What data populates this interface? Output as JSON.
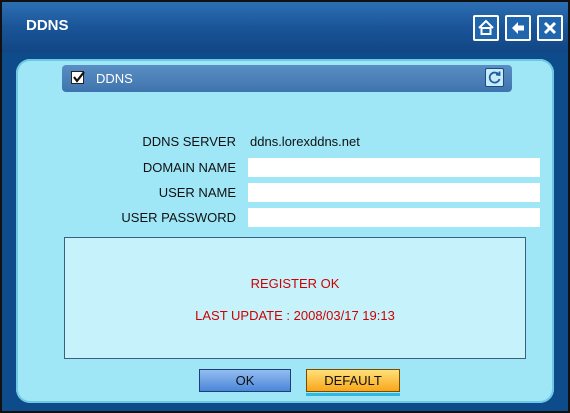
{
  "window": {
    "title": "DDNS"
  },
  "titlebar_buttons": [
    {
      "icon": "home-icon"
    },
    {
      "icon": "back-arrow-icon"
    },
    {
      "icon": "close-icon"
    }
  ],
  "section": {
    "label": "DDNS",
    "checked": true,
    "refresh_icon": "refresh-icon"
  },
  "fields": {
    "server_label": "DDNS SERVER",
    "server_value": "ddns.lorexddns.net",
    "domain_label": "DOMAIN NAME",
    "domain_value": "",
    "user_label": "USER NAME",
    "user_value": "",
    "password_label": "USER PASSWORD",
    "password_value": ""
  },
  "status": {
    "message": "REGISTER OK",
    "last_update": "LAST UPDATE : 2008/03/17 19:13"
  },
  "buttons": {
    "ok_label": "OK",
    "default_label": "DEFAULT"
  },
  "colors": {
    "titlebar": "#1a5598",
    "panel": "#9fe7f7",
    "status_text": "#d00000",
    "ok_button": "#4b86d8",
    "default_button": "#f9a61a"
  }
}
